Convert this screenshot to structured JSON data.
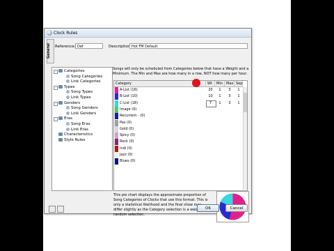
{
  "window": {
    "title": "Clock Rules",
    "side_tab": "General"
  },
  "fields": {
    "reference_label": "Reference:",
    "reference_value": "Def",
    "description_label": "Description:",
    "description_value": "Hot FM Default"
  },
  "tree": [
    {
      "label": "Categories",
      "depth": 0,
      "toggle": "-"
    },
    {
      "label": "Song Categories",
      "depth": 1
    },
    {
      "label": "Link Categories",
      "depth": 1
    },
    {
      "label": "Types",
      "depth": 0,
      "toggle": "-"
    },
    {
      "label": "Song Types",
      "depth": 1
    },
    {
      "label": "Link Types",
      "depth": 1
    },
    {
      "label": "Genders",
      "depth": 0,
      "toggle": "-"
    },
    {
      "label": "Song Genders",
      "depth": 1
    },
    {
      "label": "Link Genders",
      "depth": 1
    },
    {
      "label": "Eras",
      "depth": 0,
      "toggle": "-"
    },
    {
      "label": "Song Eras",
      "depth": 1
    },
    {
      "label": "Link Eras",
      "depth": 1
    },
    {
      "label": "Characteristics",
      "depth": 0
    },
    {
      "label": "Style Rules",
      "depth": 0
    }
  ],
  "info_text": "Songs will only be scheduled from Categories below that have a Weight and a Minimum. The Min and Max are how many in a row, NOT how many per hour.",
  "table": {
    "headers": {
      "category": "Category",
      "weight": "Wt",
      "min": "Min",
      "max": "Max",
      "sep": "Sep"
    },
    "rows": [
      {
        "name": "A-List  (16)",
        "color": "#e0208c",
        "weight": "20",
        "min": "1",
        "max": "3",
        "sep": "1"
      },
      {
        "name": "B-List  (10)",
        "color": "#2a2ad2",
        "weight": "10",
        "min": "1",
        "max": "3",
        "sep": "1"
      },
      {
        "name": "C-List  (18)",
        "color": "#39d6e0",
        "weight": "7",
        "min": "1",
        "max": "3",
        "sep": "1"
      },
      {
        "name": "Image  (0)",
        "color": "#58c858",
        "weight": "",
        "min": "",
        "max": "",
        "sep": ""
      },
      {
        "name": "Recurrent -  (0)",
        "color": "#1a1aa8",
        "weight": "",
        "min": "",
        "max": "",
        "sep": ""
      },
      {
        "name": "Pas  (0)",
        "color": "#a0a0a0",
        "weight": "",
        "min": "",
        "max": "",
        "sep": ""
      },
      {
        "name": "Gold  (0)",
        "color": "#d8d8d8",
        "weight": "",
        "min": "",
        "max": "",
        "sep": ""
      },
      {
        "name": "Spicy  (0)",
        "color": "#c8a8c8",
        "weight": "",
        "min": "",
        "max": "",
        "sep": ""
      },
      {
        "name": "Rock  (0)",
        "color": "#7a2a7a",
        "weight": "",
        "min": "",
        "max": "",
        "sep": ""
      },
      {
        "name": "Indi  (0)",
        "color": "#b01818",
        "weight": "",
        "min": "",
        "max": "",
        "sep": ""
      },
      {
        "name": "Jazz  (0)",
        "color": "#f0f0f0",
        "weight": "",
        "min": "",
        "max": "",
        "sep": ""
      },
      {
        "name": "Blues  (0)",
        "color": "#101080",
        "weight": "",
        "min": "",
        "max": "",
        "sep": ""
      }
    ]
  },
  "pie_text": "This pie chart displays the approximate proportion of Song Categories of Clocks that use this format. This is only a statistical likelihood and the final show may differ slightly as the Category selection is a weighted random selection.",
  "pie_shares": [
    {
      "value": 20,
      "color": "#e0208c"
    },
    {
      "value": 10,
      "color": "#2a2ad2"
    },
    {
      "value": 7,
      "color": "#39d6e0"
    }
  ],
  "buttons": {
    "ok": "OK",
    "cancel": "Cancel"
  }
}
